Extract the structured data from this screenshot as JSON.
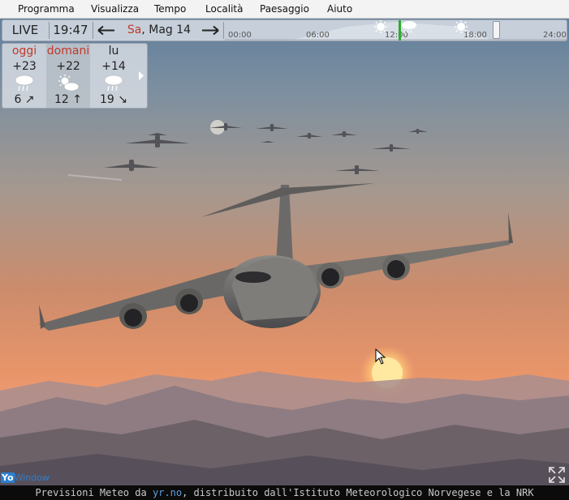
{
  "menu": [
    "Programma",
    "Visualizza",
    "Tempo",
    "Località",
    "Paesaggio",
    "Aiuto"
  ],
  "timebar": {
    "live": "LIVE",
    "time": "19:47",
    "date_day": "Sa",
    "date_rest": ", Mag 14",
    "ticks": [
      "00:00",
      "06:00",
      "12:00",
      "18:00",
      "24:00"
    ]
  },
  "forecast": [
    {
      "day": "oggi",
      "temp": "+23",
      "icon": "rain-cloud-icon",
      "wind": "6 ↗"
    },
    {
      "day": "domani",
      "temp": "+22",
      "icon": "sun-cloud-icon",
      "wind": "12 ↑"
    },
    {
      "day": "lu",
      "temp": "+14",
      "icon": "rain-cloud-icon",
      "wind": "19 ↘"
    }
  ],
  "status": {
    "pre": "Previsioni Meteo da ",
    "link": "yr.no",
    "post": ", distribuito dall'Istituto Meteorologico Norvegese e la NRK"
  },
  "logo": {
    "yo": "Yo",
    "window": "Window"
  },
  "colors": {
    "weekend": "#c0392b",
    "link": "#5f9fe0"
  }
}
